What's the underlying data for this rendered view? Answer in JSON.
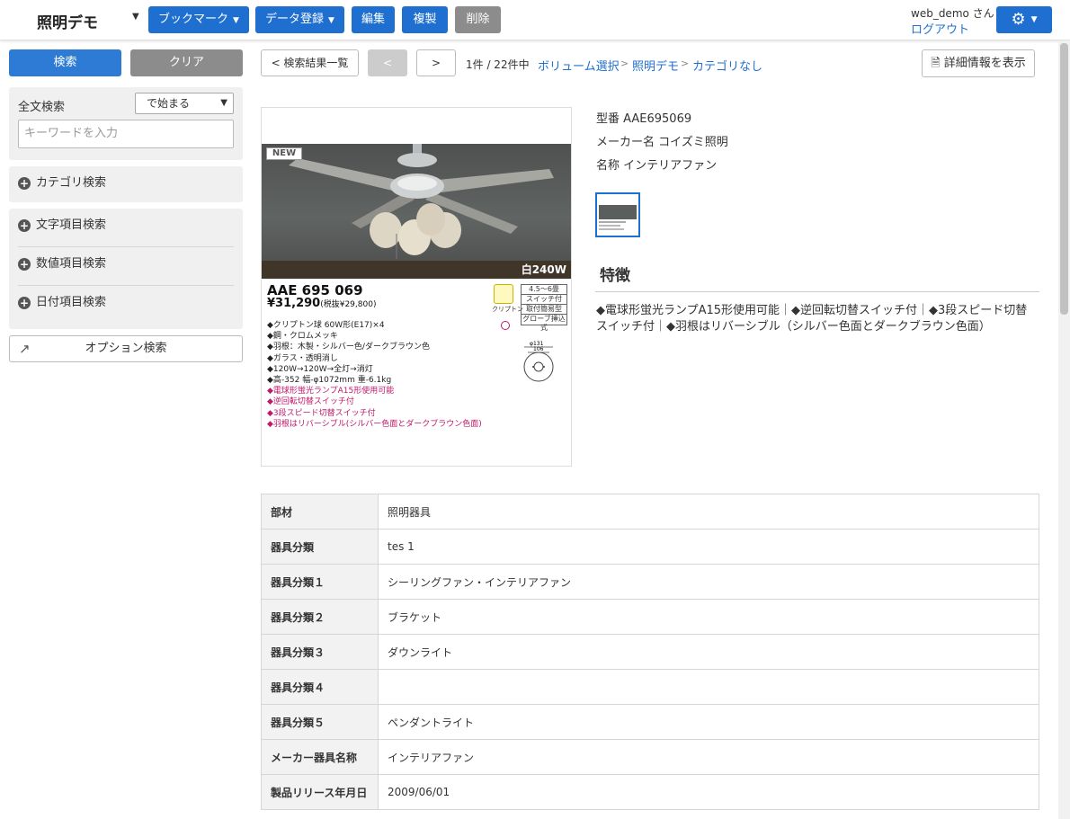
{
  "header": {
    "app_title": "照明デモ",
    "buttons": {
      "bookmark": "ブックマーク",
      "data_register": "データ登録",
      "edit": "編集",
      "duplicate": "複製",
      "delete": "削除"
    },
    "user_name": "web_demo さん",
    "logout": "ログアウト",
    "settings_icon": "gear-icon"
  },
  "sidebar": {
    "search_button": "検索",
    "clear_button": "クリア",
    "fulltext": {
      "label": "全文検索",
      "mode_selected": "で始まる",
      "placeholder": "キーワードを入力"
    },
    "category_search": "カテゴリ検索",
    "text_field_search": "文字項目検索",
    "numeric_field_search": "数値項目検索",
    "date_field_search": "日付項目検索",
    "option_search": "オプション検索"
  },
  "nav": {
    "back_to_results": "< 検索結果一覧",
    "prev": "<",
    "next": ">",
    "count": "1件 / 22件中",
    "breadcrumb": [
      "ボリューム選択",
      "照明デモ",
      "カテゴリなし"
    ],
    "breadcrumb_sep": ">",
    "detail_button": "詳細情報を表示"
  },
  "product_image": {
    "badge": "NEW",
    "wattage": "白240W",
    "code": "AAE 695 069",
    "price": "¥31,290",
    "price_tax": "(税抜¥29,800)",
    "tags": [
      "4.5～6畳",
      "スイッチ付",
      "取付簡易型",
      "グローブ挿込式"
    ],
    "bulb_label": "クリプトン",
    "specs": [
      {
        "text": "◆クリプトン球 60W形(E17)×4",
        "highlight": false
      },
      {
        "text": "◆鋼・クロムメッキ",
        "highlight": false
      },
      {
        "text": "◆羽根：木製・シルバー色/ダークブラウン色",
        "highlight": false
      },
      {
        "text": "◆ガラス・透明消し",
        "highlight": false
      },
      {
        "text": "◆120W→120W→全灯→消灯",
        "highlight": false
      },
      {
        "text": "◆高-352 幅-φ1072mm 重-6.1kg",
        "highlight": false
      },
      {
        "text": "◆電球形蛍光ランプA15形使用可能",
        "highlight": true
      },
      {
        "text": "◆逆回転切替スイッチ付",
        "highlight": true
      },
      {
        "text": "◆3段スピード切替スイッチ付",
        "highlight": true
      },
      {
        "text": "◆羽根はリバーシブル(シルバー色面とダークブラウン色面)",
        "highlight": true
      }
    ],
    "dim_labels": [
      "φ131",
      "106"
    ]
  },
  "product_info": {
    "model": "型番 AAE695069",
    "maker": "メーカー名 コイズミ照明",
    "name": "名称 インテリアファン",
    "feature_title": "特徴",
    "feature_text": "◆電球形蛍光ランプA15形使用可能｜◆逆回転切替スイッチ付｜◆3段スピード切替スイッチ付｜◆羽根はリバーシブル（シルバー色面とダークブラウン色面）"
  },
  "spec_table": [
    {
      "key": "部材",
      "value": "照明器具"
    },
    {
      "key": "器具分類",
      "value": "tes 1"
    },
    {
      "key": "器具分類１",
      "value": "シーリングファン・インテリアファン"
    },
    {
      "key": "器具分類２",
      "value": "ブラケット"
    },
    {
      "key": "器具分類３",
      "value": "ダウンライト"
    },
    {
      "key": "器具分類４",
      "value": ""
    },
    {
      "key": "器具分類５",
      "value": "ペンダントライト"
    },
    {
      "key": "メーカー器具名称",
      "value": "インテリアファン"
    },
    {
      "key": "製品リリース年月日",
      "value": "2009/06/01"
    }
  ],
  "colors": {
    "primary": "#1f6fd0",
    "disabled": "#8c8c8c",
    "highlight": "#c0186a"
  }
}
